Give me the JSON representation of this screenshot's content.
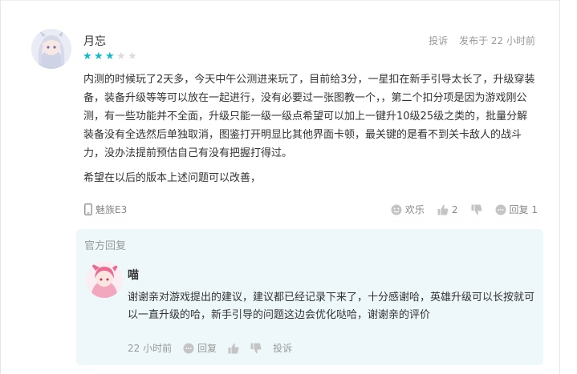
{
  "review": {
    "username": "月忘",
    "rating": 3,
    "rating_max": 5,
    "report_label": "投诉",
    "time_label": "发布于 22 小时前",
    "body": "内测的时候玩了2天多，今天中午公测进来玩了，目前给3分，一星扣在新手引导太长了，升级穿装备，装备升级等等可以放在一起进行，没有必要过一张图教一个，，第二个扣分项是因为游戏刚公测，有一些功能并不全面，升级只能一级一级点希望可以加上一键升10级25级之类的，批量分解装备没有全选然后单独取消，图鉴打开明显比其他界面卡顿，最关键的是看不到关卡敌人的战斗力，没办法提前预估自己有没有把握打得过。",
    "body2": "希望在以后的版本上述问题可以改善，",
    "device": "魅族E3",
    "actions": {
      "fun_label": "欢乐",
      "like_count": "2",
      "reply_label": "回复 1"
    }
  },
  "official_reply": {
    "title": "官方回复",
    "name": "喵",
    "text": "谢谢亲对游戏提出的建议，建议都已经记录下来了，十分感谢哈，英雄升级可以长按就可以一直升级的哈，新手引导的问题这边会优化哒哈，谢谢亲的评价",
    "time": "22 小时前",
    "reply_label": "回复",
    "report_label": "投诉"
  },
  "colors": {
    "star_on": "#14b9c8",
    "star_off": "#dcdcdc",
    "official_bg": "#eef8fa"
  }
}
